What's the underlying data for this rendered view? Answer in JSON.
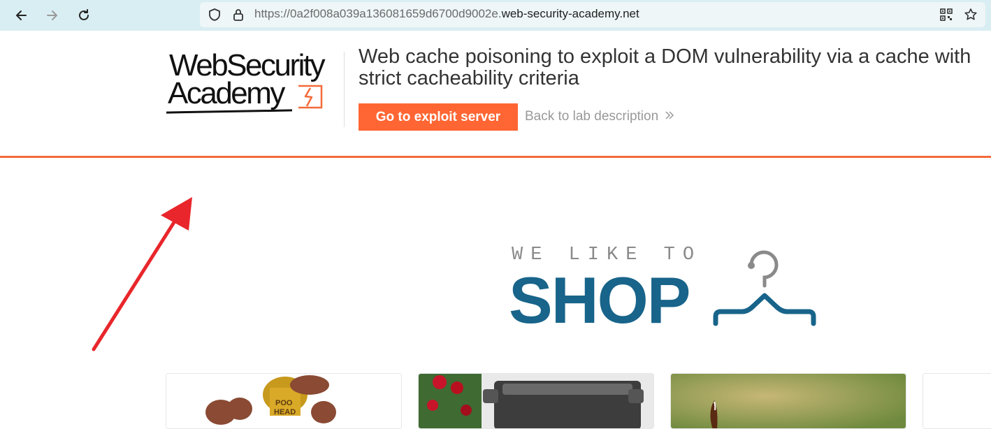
{
  "browser": {
    "url_prefix": "https://0a2f008a039a136081659d6700d9002e.",
    "url_host": "web-security-academy.net"
  },
  "header": {
    "logo_line1": "WebSecurity",
    "logo_line2": "Academy",
    "lab_title": "Web cache poisoning to exploit a DOM vulnerability via a cache with strict cacheability criteria",
    "exploit_button": "Go to exploit server",
    "back_link": "Back to lab description"
  },
  "banner": {
    "tagline": "WE LIKE TO",
    "shop": "SHOP"
  },
  "products": [
    {
      "image": "pooh-head-toy"
    },
    {
      "image": "typewriter-with-roses"
    },
    {
      "image": "green-product-photo"
    },
    {
      "image": "product-photo"
    }
  ],
  "colors": {
    "toolbar_bg": "#d9eef2",
    "accent_orange": "#ff6633",
    "shop_blue": "#18648a",
    "annotation_red": "#e8262b"
  }
}
